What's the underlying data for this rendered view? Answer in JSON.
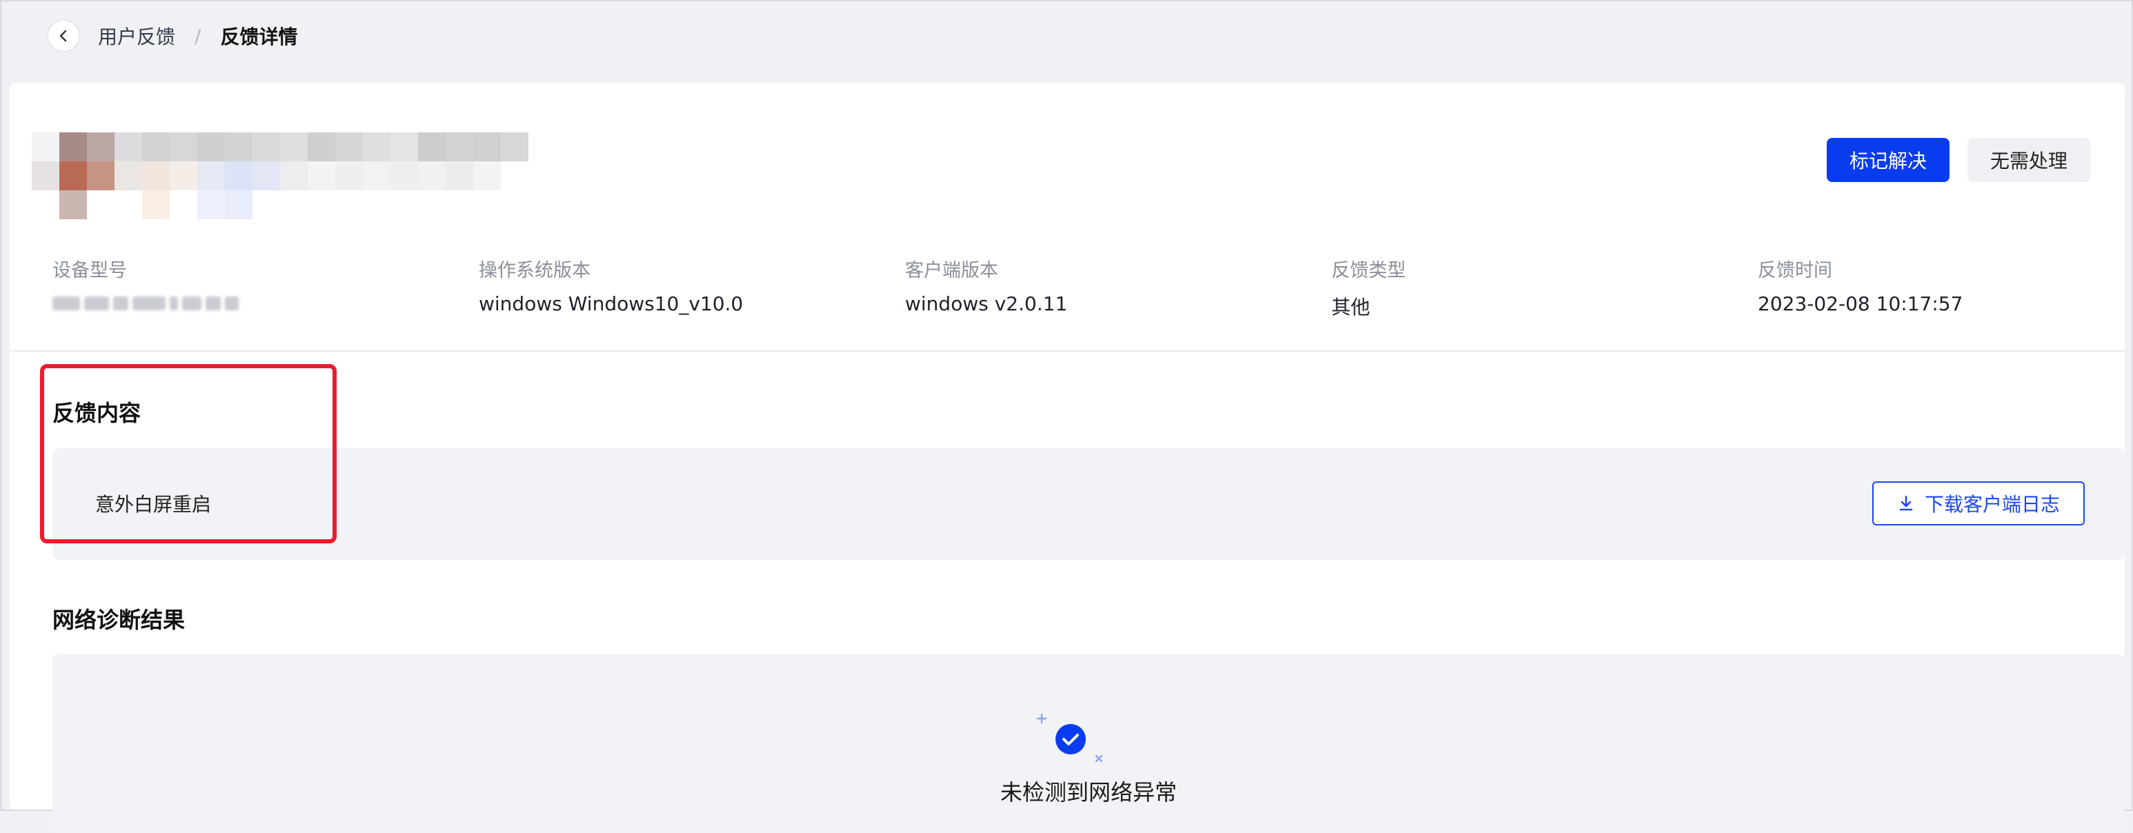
{
  "breadcrumb": {
    "parent": "用户反馈",
    "separator": "/",
    "current": "反馈详情"
  },
  "actions": {
    "resolve_label": "标记解决",
    "ignore_label": "无需处理"
  },
  "info": [
    {
      "label": "设备型号",
      "value": ""
    },
    {
      "label": "操作系统版本",
      "value": "windows Windows10_v10.0"
    },
    {
      "label": "客户端版本",
      "value": "windows v2.0.11"
    },
    {
      "label": "反馈类型",
      "value": "其他"
    },
    {
      "label": "反馈时间",
      "value": "2023-02-08 10:17:57"
    }
  ],
  "feedback": {
    "title": "反馈内容",
    "content": "意外白屏重启",
    "download_label": "下载客户端日志"
  },
  "diagnosis": {
    "title": "网络诊断结果",
    "result": "未检测到网络异常"
  },
  "colors": {
    "primary": "#0a3cef",
    "highlight": "#ec1b2e",
    "panel": "#f2f3f7"
  }
}
